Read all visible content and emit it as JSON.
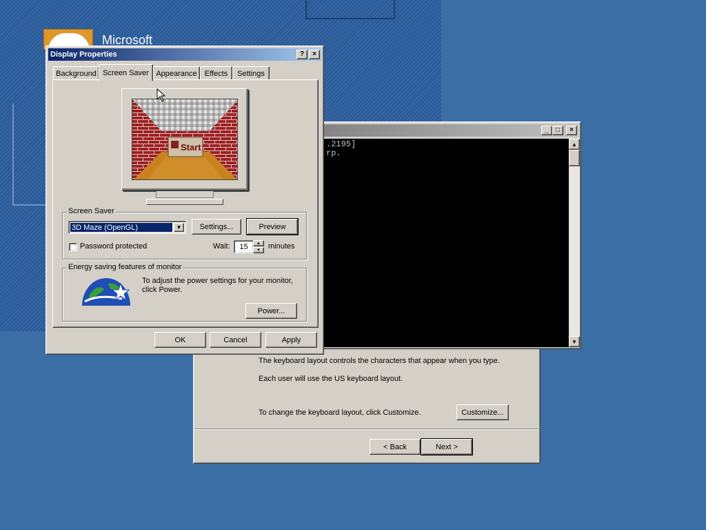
{
  "desktop": {
    "brand_text": "Microsoft",
    "background_color": "#3a6ea5"
  },
  "wizard": {
    "line1": "The keyboard layout controls the characters that appear when you type.",
    "line2": "Each user will use the US keyboard layout.",
    "line3": "To change the keyboard layout, click Customize.",
    "customize_label": "Customize...",
    "back_label": "< Back",
    "next_label": "Next >"
  },
  "console": {
    "line1": ".2195]",
    "line2": "rp."
  },
  "dialog": {
    "title": "Display Properties",
    "help_btn": "?",
    "close_btn": "×",
    "tabs": [
      {
        "label": "Background"
      },
      {
        "label": "Screen Saver"
      },
      {
        "label": "Appearance"
      },
      {
        "label": "Effects"
      },
      {
        "label": "Settings"
      }
    ],
    "active_tab": "Screen Saver",
    "preview_label": "Start",
    "screensaver_group_label": "Screen Saver",
    "screensaver_selected": "3D Maze (OpenGL)",
    "settings_label": "Settings...",
    "preview_btn_label": "Preview",
    "password_label": "Password protected",
    "password_checked": false,
    "wait_label": "Wait:",
    "wait_value": "15",
    "minutes_label": "minutes",
    "energy_group_label": "Energy saving features of monitor",
    "energy_text_line1": "To adjust the power settings for your monitor,",
    "energy_text_line2": "click Power.",
    "power_label": "Power...",
    "ok_label": "OK",
    "cancel_label": "Cancel",
    "apply_label": "Apply",
    "accent_color": "#0a246a"
  }
}
